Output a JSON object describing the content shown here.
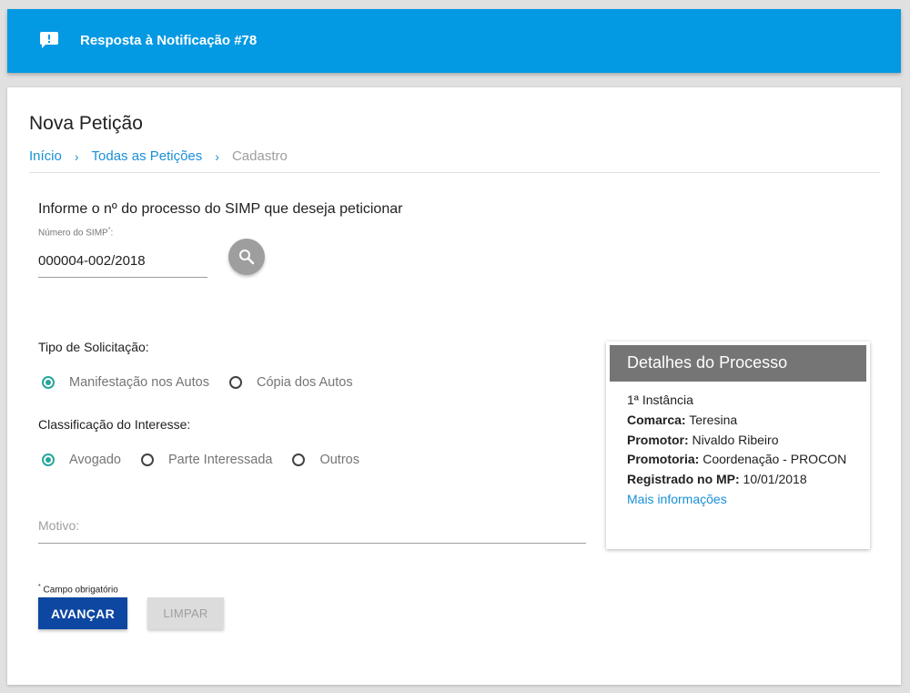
{
  "topbar": {
    "title": "Resposta à Notificação #78",
    "icon": "feedback-icon",
    "color": "#0399e3"
  },
  "page": {
    "title": "Nova Petição",
    "breadcrumb": [
      "Início",
      "Todas as Petições",
      "Cadastro"
    ]
  },
  "form": {
    "intro": "Informe o nº do processo do SIMP que deseja peticionar",
    "simp_label": "Número do SIMP",
    "simp_required_mark": "*",
    "simp_label_suffix": ":",
    "simp_value": "000004-002/2018",
    "tipo_label": "Tipo de Solicitação:",
    "tipo_options": [
      "Manifestação nos Autos",
      "Cópia dos Autos"
    ],
    "tipo_selected": "Manifestação nos Autos",
    "classificacao_label": "Classificação do Interesse:",
    "classificacao_options": [
      "Avogado",
      "Parte Interessada",
      "Outros"
    ],
    "classificacao_selected": "Avogado",
    "motivo_placeholder": "Motivo:",
    "required_mark": "*",
    "required_note": " Campo obrigatório",
    "advance_label": "AVANÇAR",
    "clear_label": "LIMPAR"
  },
  "details": {
    "title": "Detalhes do Processo",
    "instance": "1ª Instância",
    "comarca_label": "Comarca:",
    "comarca_value": " Teresina",
    "promotor_label": "Promotor:",
    "promotor_value": " Nivaldo Ribeiro",
    "promotoria_label": "Promotoria:",
    "promotoria_value": " Coordenação - PROCON",
    "registrado_label": "Registrado no MP:",
    "registrado_value": " 10/01/2018",
    "more_link": "Mais informações"
  },
  "colors": {
    "primary_button": "#0d47a1",
    "radio_checked": "#26a69a",
    "link": "#1a8fd8",
    "details_header": "#757575"
  }
}
